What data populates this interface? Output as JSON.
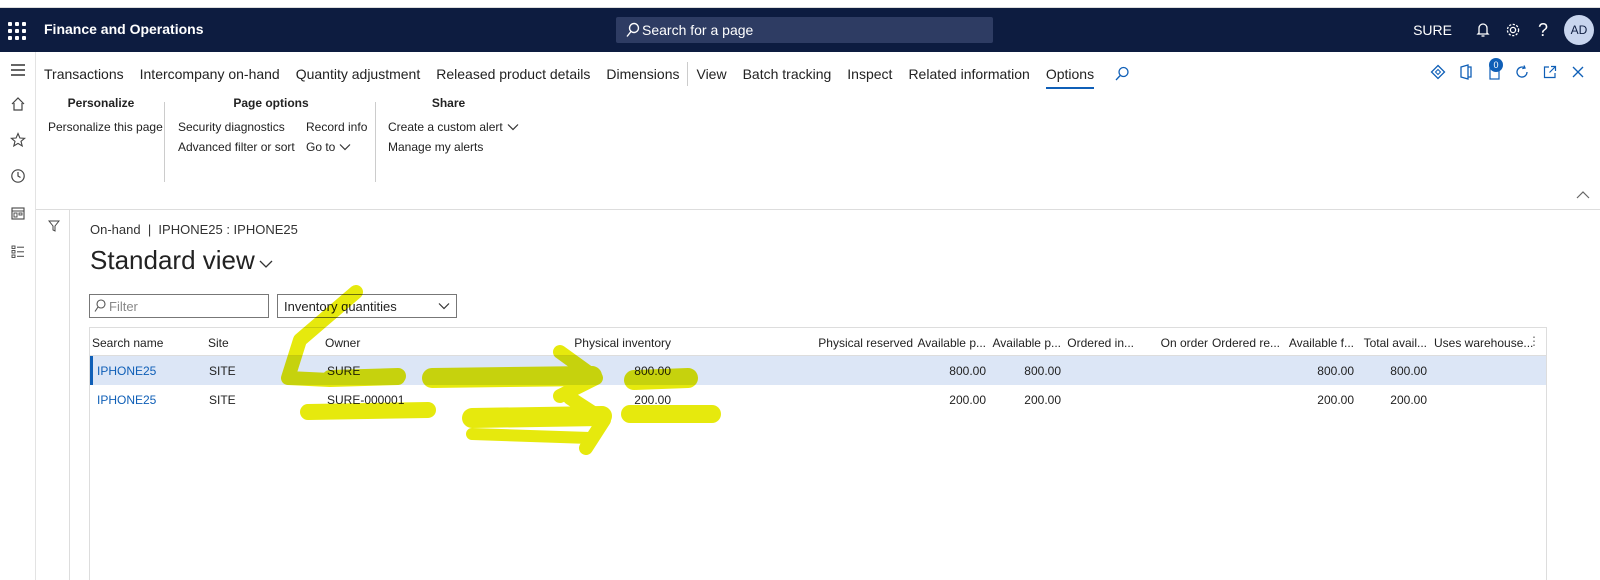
{
  "navbar": {
    "app_title": "Finance and Operations",
    "search_text": "Search for a page",
    "company": "SURE",
    "avatar_initials": "AD",
    "bg_color": "#0d1c40"
  },
  "action_tabs": [
    "Transactions",
    "Intercompany on-hand",
    "Quantity adjustment",
    "Released product details",
    "Dimensions",
    "View",
    "Batch tracking",
    "Inspect",
    "Related information",
    "Options"
  ],
  "active_tab": "Options",
  "notification_badge": "0",
  "groups": {
    "personalize": {
      "title": "Personalize",
      "personalize_page": "Personalize this page"
    },
    "page_options": {
      "title": "Page options",
      "security_diagnostics": "Security diagnostics",
      "record_info": "Record info",
      "advanced_filter": "Advanced filter or sort",
      "go_to": "Go to"
    },
    "share": {
      "title": "Share",
      "create_alert": "Create a custom alert",
      "manage_alerts": "Manage my alerts"
    }
  },
  "breadcrumb": "On-hand  |  IPHONE25 : IPHONE25",
  "view_title": "Standard view",
  "filter": {
    "placeholder": "Filter"
  },
  "quantity_select": "Inventory quantities",
  "grid": {
    "headers": {
      "search_name": "Search name",
      "site": "Site",
      "owner": "Owner",
      "physical_inventory": "Physical inventory",
      "physical_reserved": "Physical reserved",
      "available_p1": "Available p...",
      "available_p2": "Available p...",
      "ordered_in": "Ordered in...",
      "on_order": "On order",
      "ordered_re": "Ordered re...",
      "available_f": "Available f...",
      "total_avail": "Total avail...",
      "uses_warehouse": "Uses warehouse..."
    },
    "rows": [
      {
        "search_name": "IPHONE25",
        "site": "SITE",
        "owner": "SURE",
        "physical_inventory": "800.00",
        "available_p1": "800.00",
        "available_p2": "800.00",
        "available_f": "800.00",
        "total_avail": "800.00"
      },
      {
        "search_name": "IPHONE25",
        "site": "SITE",
        "owner": "SURE-000001",
        "physical_inventory": "200.00",
        "available_p1": "200.00",
        "available_p2": "200.00",
        "available_f": "200.00",
        "total_avail": "200.00"
      }
    ],
    "selected_bg": "#dce6f6"
  },
  "annotation_color": "#e5e800"
}
